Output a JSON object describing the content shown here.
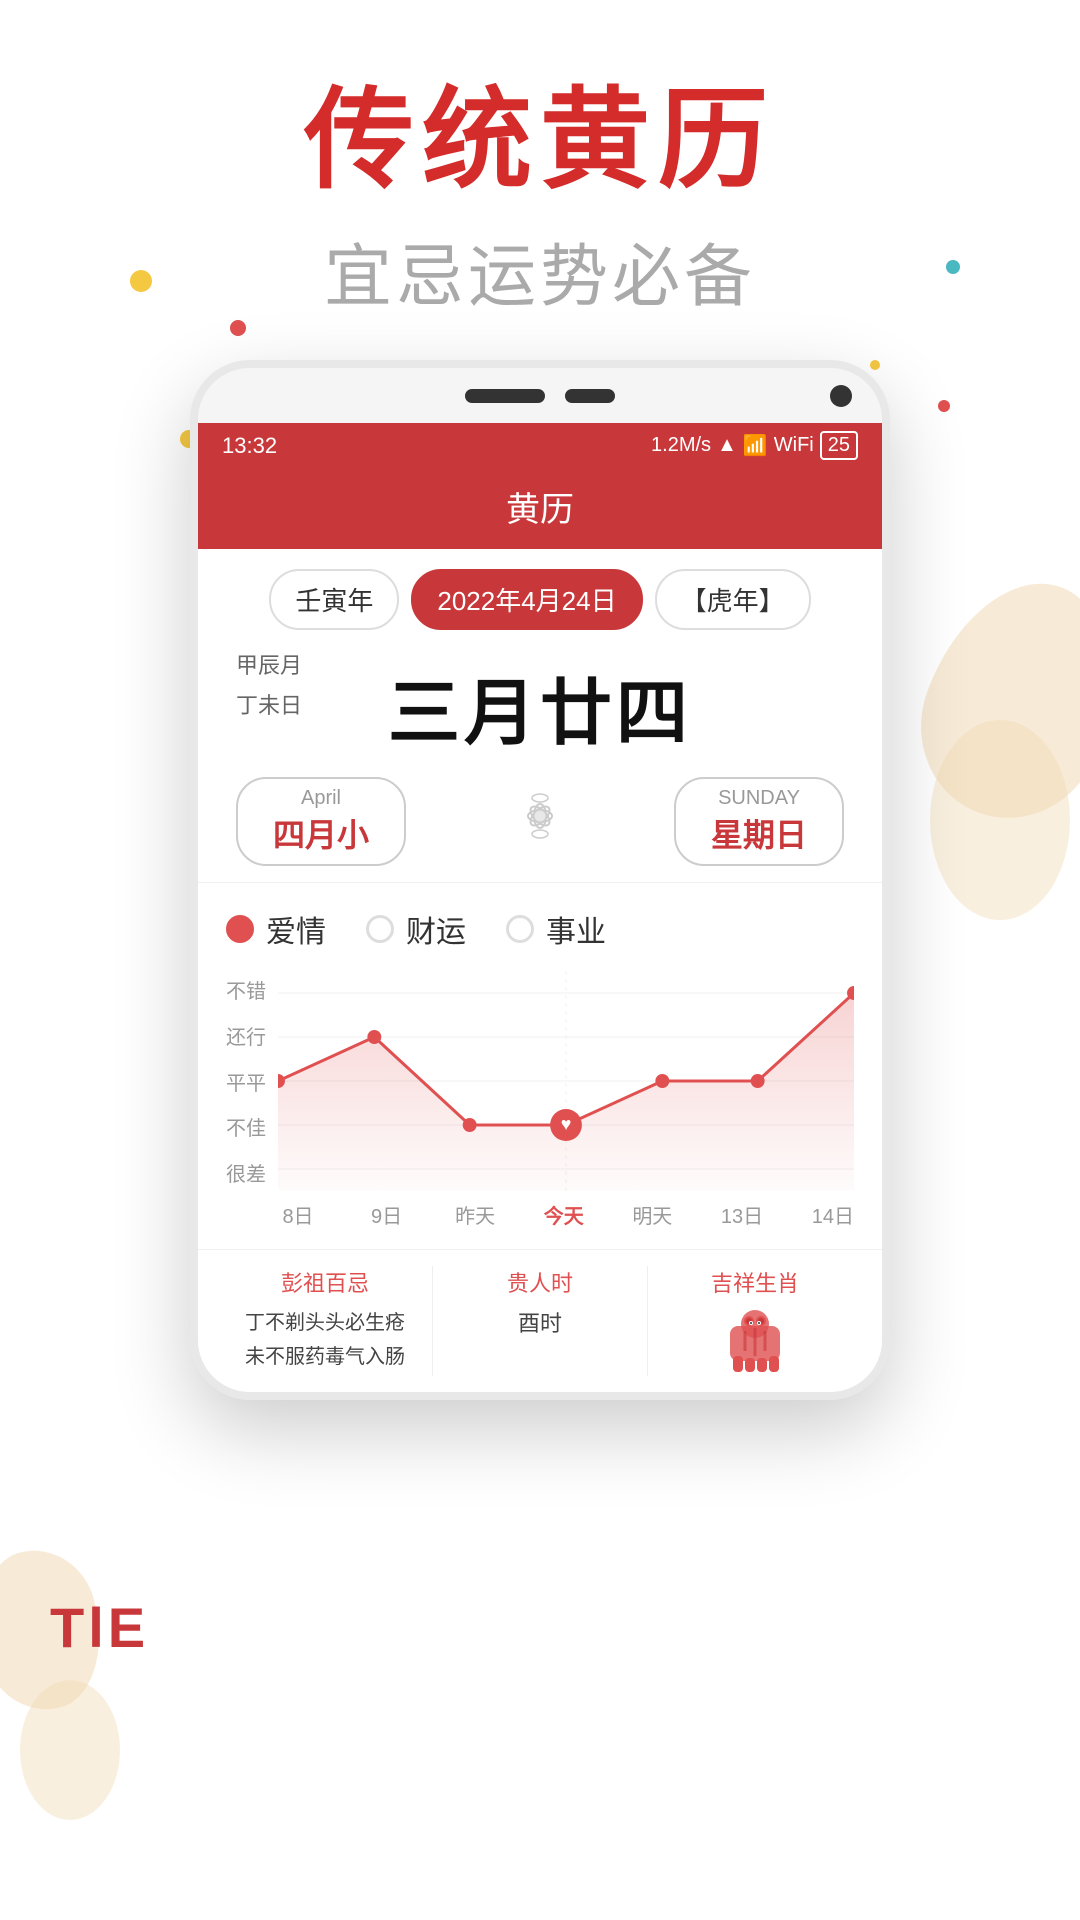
{
  "app": {
    "title": "黄历",
    "main_title": "传统黄历",
    "sub_title": "宜忌运势必备"
  },
  "status_bar": {
    "time": "13:32",
    "network_speed": "1.2M/s",
    "battery": "25"
  },
  "calendar": {
    "year_label": "壬寅年",
    "date_label": "2022年4月24日",
    "zodiac_label": "【虎年】",
    "lunar_month": "甲辰月",
    "lunar_day_label": "丁未日",
    "lunar_big": "三月廿四",
    "month_en": "April",
    "month_cn": "四月小",
    "weekday_en": "SUNDAY",
    "weekday_cn": "星期日"
  },
  "fortune": {
    "categories": [
      {
        "label": "爱情",
        "active": true
      },
      {
        "label": "财运",
        "active": false
      },
      {
        "label": "事业",
        "active": false
      }
    ],
    "y_labels": [
      "不错",
      "还行",
      "平平",
      "不佳",
      "很差"
    ],
    "x_labels": [
      {
        "label": "8日",
        "today": false
      },
      {
        "label": "9日",
        "today": false
      },
      {
        "label": "昨天",
        "today": false
      },
      {
        "label": "今天",
        "today": true
      },
      {
        "label": "明天",
        "today": false
      },
      {
        "label": "13日",
        "today": false
      },
      {
        "label": "14日",
        "today": false
      }
    ],
    "data_points": [
      {
        "x": 0,
        "y": 3
      },
      {
        "x": 1,
        "y": 2
      },
      {
        "x": 2,
        "y": 4
      },
      {
        "x": 3,
        "y": 4
      },
      {
        "x": 4,
        "y": 3
      },
      {
        "x": 5,
        "y": 3
      },
      {
        "x": 6,
        "y": 1
      }
    ]
  },
  "bottom_info": {
    "col1_title": "彭祖百忌",
    "col1_content": "丁不剃头头必生疮\n未不服药毒气入肠",
    "col2_title": "贵人时",
    "col2_content": "酉时",
    "col3_title": "吉祥生肖",
    "col3_icon": "tiger"
  },
  "colors": {
    "primary_red": "#c8383a",
    "accent_red": "#e05050",
    "light_bg": "#f8f8f8",
    "beige": "#f0d8b0"
  }
}
